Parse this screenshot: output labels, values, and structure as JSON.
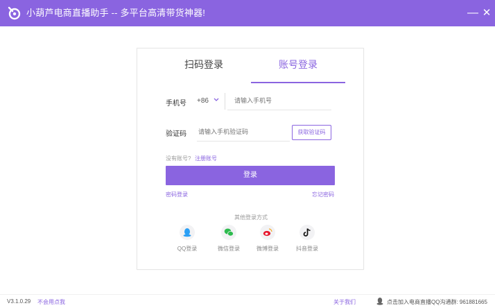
{
  "window": {
    "title": "小葫芦电商直播助手 -- 多平台高清带货神器!",
    "accent_color": "#8a64e0",
    "minimize_glyph": "—",
    "close_glyph": "✕"
  },
  "login": {
    "tabs": [
      {
        "label": "扫码登录",
        "active": false
      },
      {
        "label": "账号登录",
        "active": true
      }
    ],
    "phone_label": "手机号",
    "country_code": "+86",
    "phone_placeholder": "请输入手机号",
    "code_label": "验证码",
    "code_placeholder": "请输入手机验证码",
    "get_code_label": "获取验证码",
    "no_account_text": "没有账号?",
    "register_link": "注册账号",
    "login_button": "登录",
    "password_login_link": "密码登录",
    "forgot_password_link": "忘记密码",
    "other_methods_title": "其他登录方式",
    "social": [
      {
        "label": "QQ登录",
        "icon": "qq-icon"
      },
      {
        "label": "微信登录",
        "icon": "wechat-icon"
      },
      {
        "label": "微博登录",
        "icon": "weibo-icon"
      },
      {
        "label": "抖音登录",
        "icon": "douyin-icon"
      }
    ]
  },
  "footer": {
    "version": "V3.1.0.29",
    "disable_link": "不会用点我",
    "about_link": "关于我们",
    "qq_group_text": "点击加入电商直播QQ沟通群: 961881665"
  }
}
